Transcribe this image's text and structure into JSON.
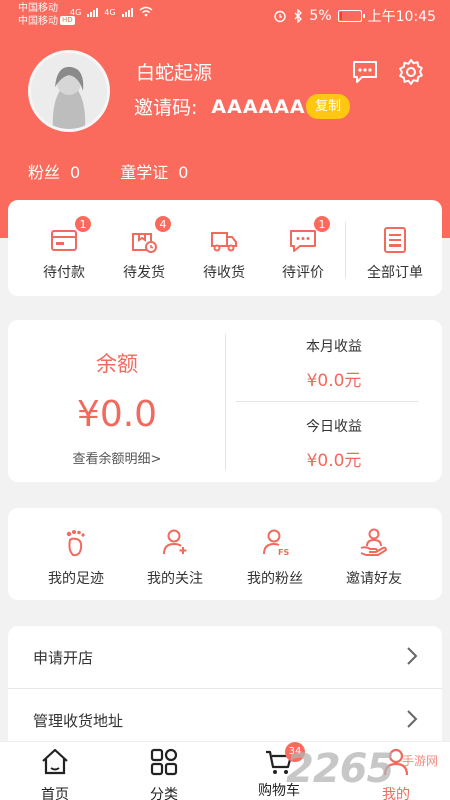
{
  "status_bar": {
    "carrier1": "中国移动",
    "carrier2": "中国移动",
    "network1": "4G",
    "network2": "4G",
    "hd": "HD",
    "battery": "5%",
    "time": "上午10:45"
  },
  "profile": {
    "username": "白蛇起源",
    "invite_label": "邀请码:",
    "invite_code": "AAAAAA",
    "copy_label": "复制",
    "fans_label": "粉丝",
    "fans_value": "0",
    "cert_label": "童学证",
    "cert_value": "0"
  },
  "orders": [
    {
      "label": "待付款",
      "badge": "1",
      "icon": "wallet-icon"
    },
    {
      "label": "待发货",
      "badge": "4",
      "icon": "package-clock-icon"
    },
    {
      "label": "待收货",
      "badge": "",
      "icon": "truck-icon"
    },
    {
      "label": "待评价",
      "badge": "1",
      "icon": "comment-icon"
    },
    {
      "label": "全部订单",
      "badge": "",
      "icon": "list-icon"
    }
  ],
  "balance": {
    "title": "余额",
    "amount": "¥0.0",
    "detail_link": "查看余额明细>",
    "month_label": "本月收益",
    "month_value": "¥0.0元",
    "today_label": "今日收益",
    "today_value": "¥0.0元"
  },
  "social": [
    {
      "label": "我的足迹",
      "icon": "footprint-icon"
    },
    {
      "label": "我的关注",
      "icon": "user-add-icon"
    },
    {
      "label": "我的粉丝",
      "icon": "user-fans-icon"
    },
    {
      "label": "邀请好友",
      "icon": "invite-hand-icon"
    }
  ],
  "menu": [
    {
      "label": "申请开店"
    },
    {
      "label": "管理收货地址"
    }
  ],
  "tabbar": [
    {
      "label": "首页",
      "icon": "home-icon"
    },
    {
      "label": "分类",
      "icon": "grid-icon"
    },
    {
      "label": "购物车",
      "icon": "cart-icon",
      "badge": "34"
    },
    {
      "label": "我的",
      "icon": "user-icon"
    }
  ],
  "watermark": {
    "text": "2265",
    "tag": "手游网"
  },
  "colors": {
    "primary": "#fa6b5e",
    "accent": "#ffc70f",
    "text": "#333333"
  }
}
